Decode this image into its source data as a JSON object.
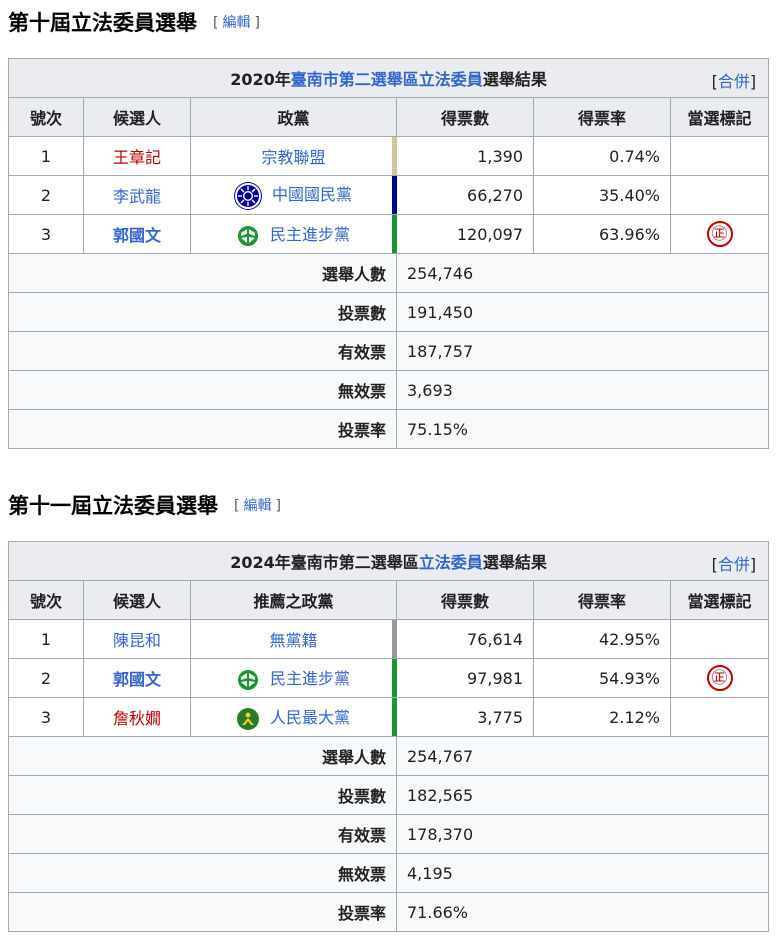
{
  "edit_label": "編輯",
  "merge_label": "合併",
  "columns_a": [
    "號次",
    "候選人",
    "政黨",
    "得票數",
    "得票率",
    "當選標記"
  ],
  "columns_b": [
    "號次",
    "候選人",
    "推薦之政黨",
    "得票數",
    "得票率",
    "當選標記"
  ],
  "elected_symbol": "㊣",
  "section1": {
    "heading": "第十屆立法委員選舉",
    "caption_year": "2020年",
    "caption_link": "臺南市第二選舉區立法委員",
    "caption_tail": "選舉結果",
    "rows": [
      {
        "no": "1",
        "name": "王章記",
        "party": "宗教聯盟",
        "votes": "1,390",
        "pct": "0.74%",
        "bar": "#d4c5a0"
      },
      {
        "no": "2",
        "name": "李武龍",
        "party": "中國國民黨",
        "votes": "66,270",
        "pct": "35.40%",
        "bar": "#000095"
      },
      {
        "no": "3",
        "name": "郭國文",
        "party": "民主進步黨",
        "votes": "120,097",
        "pct": "63.96%",
        "bar": "#1b9431"
      }
    ],
    "summary": [
      {
        "label": "選舉人數",
        "value": "254,746"
      },
      {
        "label": "投票數",
        "value": "191,450"
      },
      {
        "label": "有效票",
        "value": "187,757"
      },
      {
        "label": "無效票",
        "value": "3,693"
      },
      {
        "label": "投票率",
        "value": "75.15%"
      }
    ]
  },
  "section2": {
    "heading": "第十一屆立法委員選舉",
    "caption_year": "2024年臺南市第二選舉區",
    "caption_link": "立法委員",
    "caption_tail": "選舉結果",
    "rows": [
      {
        "no": "1",
        "name": "陳昆和",
        "party": "無黨籍",
        "votes": "76,614",
        "pct": "42.95%",
        "bar": "#999999"
      },
      {
        "no": "2",
        "name": "郭國文",
        "party": "民主進步黨",
        "votes": "97,981",
        "pct": "54.93%",
        "bar": "#1b9431"
      },
      {
        "no": "3",
        "name": "詹秋嫺",
        "party": "人民最大黨",
        "votes": "3,775",
        "pct": "2.12%",
        "bar": "#1b9431"
      }
    ],
    "summary": [
      {
        "label": "選舉人數",
        "value": "254,767"
      },
      {
        "label": "投票數",
        "value": "182,565"
      },
      {
        "label": "有效票",
        "value": "178,370"
      },
      {
        "label": "無效票",
        "value": "4,195"
      },
      {
        "label": "投票率",
        "value": "71.66%"
      }
    ]
  }
}
